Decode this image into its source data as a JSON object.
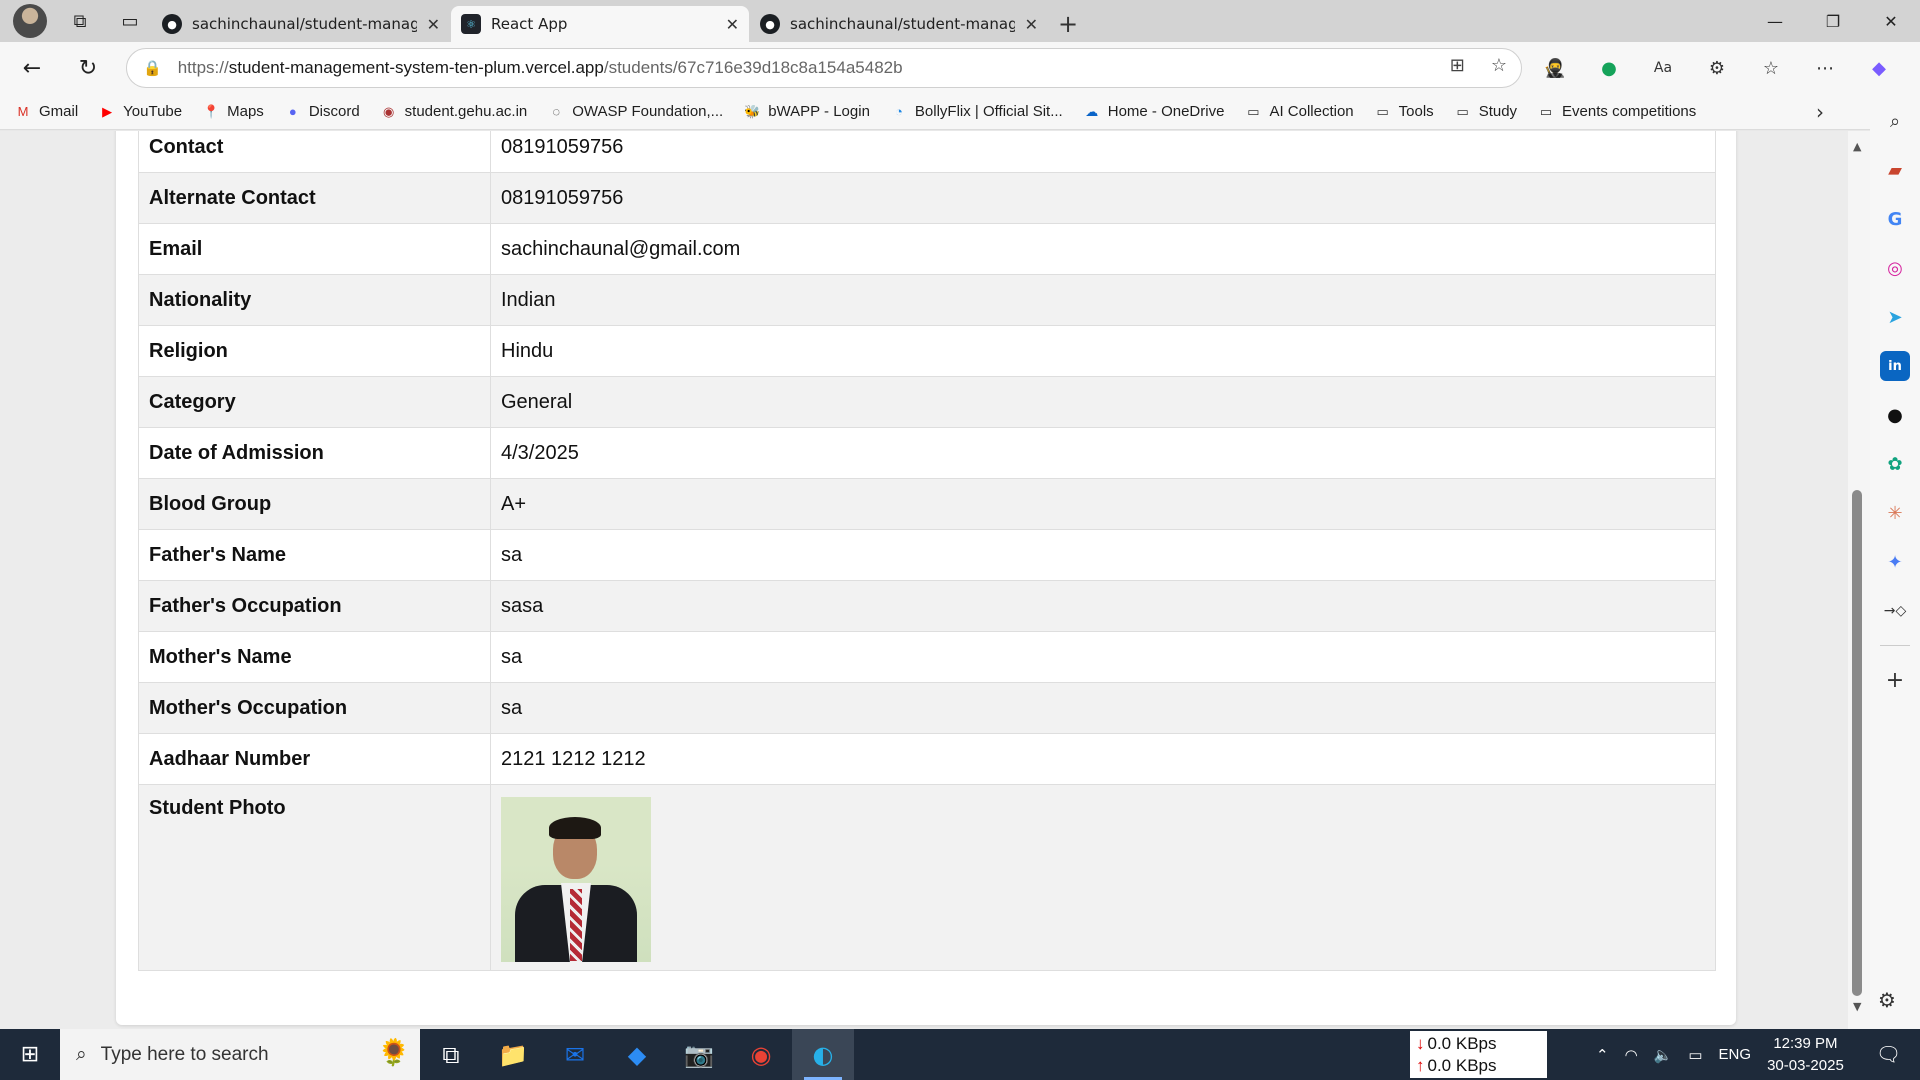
{
  "browser": {
    "tabs": [
      {
        "title": "sachinchaunal/student-managem",
        "icon": "github-icon",
        "active": false
      },
      {
        "title": "React App",
        "icon": "react-icon",
        "active": true
      },
      {
        "title": "sachinchaunal/student-managem",
        "icon": "github-icon",
        "active": false
      }
    ],
    "url_scheme": "https://",
    "url_host": "student-management-system-ten-plum.vercel.app",
    "url_path": "/students/67c716e39d18c8a154a5482b"
  },
  "bookmarks": [
    {
      "label": "Gmail",
      "icon": "gmail-icon"
    },
    {
      "label": "YouTube",
      "icon": "youtube-icon"
    },
    {
      "label": "Maps",
      "icon": "maps-icon"
    },
    {
      "label": "Discord",
      "icon": "discord-icon"
    },
    {
      "label": "student.gehu.ac.in",
      "icon": "gehu-icon"
    },
    {
      "label": "OWASP Foundation,...",
      "icon": "owasp-icon"
    },
    {
      "label": "bWAPP - Login",
      "icon": "bwapp-icon"
    },
    {
      "label": "BollyFlix | Official Sit...",
      "icon": "bollyflix-icon"
    },
    {
      "label": "Home - OneDrive",
      "icon": "onedrive-icon"
    },
    {
      "label": "AI Collection",
      "icon": "folder-icon"
    },
    {
      "label": "Tools",
      "icon": "folder-icon"
    },
    {
      "label": "Study",
      "icon": "folder-icon"
    },
    {
      "label": "Events competitions",
      "icon": "folder-icon"
    }
  ],
  "student": {
    "rows": [
      {
        "label": "Contact",
        "value": "08191059756"
      },
      {
        "label": "Alternate Contact",
        "value": "08191059756"
      },
      {
        "label": "Email",
        "value": "sachinchaunal@gmail.com"
      },
      {
        "label": "Nationality",
        "value": "Indian"
      },
      {
        "label": "Religion",
        "value": "Hindu"
      },
      {
        "label": "Category",
        "value": "General"
      },
      {
        "label": "Date of Admission",
        "value": "4/3/2025"
      },
      {
        "label": "Blood Group",
        "value": "A+"
      },
      {
        "label": "Father's Name",
        "value": "sa"
      },
      {
        "label": "Father's Occupation",
        "value": "sasa"
      },
      {
        "label": "Mother's Name",
        "value": "sa"
      },
      {
        "label": "Mother's Occupation",
        "value": "sa"
      },
      {
        "label": "Aadhaar Number",
        "value": "2121 1212 1212"
      }
    ],
    "photo_label": "Student Photo"
  },
  "taskbar": {
    "search_placeholder": "Type here to search",
    "net_down": "0.0 KBps",
    "net_up": "0.0 KBps",
    "lang": "ENG",
    "time": "12:39 PM",
    "date": "30-03-2025"
  },
  "colors": {
    "taskbar_bg": "#1e2a3a",
    "row_alt": "#f2f2f2",
    "tabbar_bg": "#d3d3d3"
  }
}
